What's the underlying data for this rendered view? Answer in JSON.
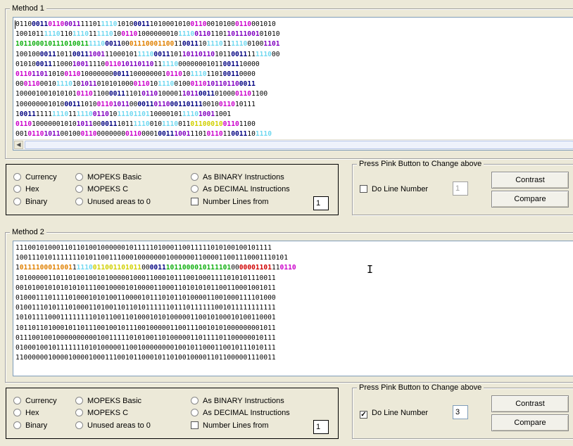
{
  "palette": {
    "black": "#000000",
    "navy": "#000080",
    "purple": "#8000c0",
    "magenta": "#cc00cc",
    "cyan": "#70d8f0",
    "green": "#10b010",
    "orange": "#e08000",
    "yellow": "#d0d000",
    "red": "#d00000"
  },
  "method1": {
    "title": "Method 1",
    "lines": [
      [
        [
          "0110",
          "black"
        ],
        [
          "0011",
          "navy",
          true
        ],
        [
          "0110",
          "magenta",
          true
        ],
        [
          "0011",
          "purple",
          true
        ],
        [
          "11101",
          "black"
        ],
        [
          "1110",
          "cyan",
          true
        ],
        [
          "1010",
          "black"
        ],
        [
          "0011",
          "navy",
          true
        ],
        [
          "1010001010",
          "black"
        ],
        [
          "0110",
          "magenta",
          true
        ],
        [
          "0010100",
          "black"
        ],
        [
          "0110",
          "magenta",
          true
        ],
        [
          "001010",
          "black"
        ]
      ],
      [
        [
          "1001011",
          "black"
        ],
        [
          "1110",
          "cyan",
          true
        ],
        [
          "110",
          "black"
        ],
        [
          "1110",
          "cyan",
          true
        ],
        [
          "11",
          "black"
        ],
        [
          "1110",
          "cyan",
          true
        ],
        [
          "10",
          "black"
        ],
        [
          "0110",
          "magenta",
          true
        ],
        [
          "1000000010",
          "black"
        ],
        [
          "1110",
          "cyan",
          true
        ],
        [
          "0110",
          "purple",
          true
        ],
        [
          "1101",
          "black"
        ],
        [
          "1011",
          "purple",
          true
        ],
        [
          "1001",
          "purple",
          true
        ],
        [
          "01010",
          "black"
        ]
      ],
      [
        [
          "101100010111010011",
          "green",
          true
        ],
        [
          "1110",
          "cyan",
          true
        ],
        [
          "0011",
          "navy",
          true
        ],
        [
          "00",
          "black"
        ],
        [
          "0111000",
          "orange",
          true
        ],
        [
          "1100",
          "orange",
          true
        ],
        [
          "11",
          "black"
        ],
        [
          "0011",
          "navy",
          true
        ],
        [
          "10",
          "black"
        ],
        [
          "1110",
          "cyan",
          true
        ],
        [
          "11",
          "black"
        ],
        [
          "1110",
          "cyan",
          true
        ],
        [
          "0100",
          "black"
        ],
        [
          "1101",
          "purple",
          true
        ]
      ],
      [
        [
          "100100",
          "black"
        ],
        [
          "0011",
          "navy",
          true
        ],
        [
          "1011",
          "black"
        ],
        [
          "0011",
          "navy",
          true
        ],
        [
          "1001",
          "purple",
          true
        ],
        [
          "11000101",
          "black"
        ],
        [
          "1110",
          "cyan",
          true
        ],
        [
          "0011",
          "navy",
          true
        ],
        [
          "101",
          "black"
        ],
        [
          "1011",
          "purple",
          true
        ],
        [
          "0110",
          "purple",
          true
        ],
        [
          "1011",
          "black"
        ],
        [
          "0011",
          "navy",
          true
        ],
        [
          "11",
          "black"
        ],
        [
          "1110",
          "cyan",
          true
        ],
        [
          "00",
          "black"
        ]
      ],
      [
        [
          "01010",
          "black"
        ],
        [
          "0011",
          "navy",
          true
        ],
        [
          "11000",
          "black"
        ],
        [
          "1001",
          "purple",
          true
        ],
        [
          "1110",
          "black"
        ],
        [
          "0110",
          "magenta",
          true
        ],
        [
          "1011",
          "purple",
          true
        ],
        [
          "0110",
          "purple",
          true
        ],
        [
          "11",
          "black"
        ],
        [
          "1110",
          "cyan",
          true
        ],
        [
          "00000001011",
          "black"
        ],
        [
          "0011",
          "navy",
          true
        ],
        [
          "10000",
          "black"
        ]
      ],
      [
        [
          "0110",
          "magenta",
          true
        ],
        [
          "1101",
          "purple",
          true
        ],
        [
          "1010",
          "black"
        ],
        [
          "0110",
          "magenta",
          true
        ],
        [
          "10",
          "black"
        ],
        [
          "000000",
          "black"
        ],
        [
          "0011",
          "navy",
          true
        ],
        [
          "100000001",
          "black"
        ],
        [
          "0110",
          "magenta",
          true
        ],
        [
          "10",
          "black"
        ],
        [
          "1110",
          "cyan",
          true
        ],
        [
          "1101",
          "black"
        ],
        [
          "0011",
          "navy",
          true
        ],
        [
          "0000",
          "black"
        ]
      ],
      [
        [
          "00",
          "black"
        ],
        [
          "0110",
          "magenta",
          true
        ],
        [
          "0010",
          "black"
        ],
        [
          "1110",
          "cyan",
          true
        ],
        [
          "10",
          "black"
        ],
        [
          "1011",
          "purple",
          true
        ],
        [
          "010101000",
          "black"
        ],
        [
          "0110",
          "magenta",
          true
        ],
        [
          "10",
          "black"
        ],
        [
          "1110",
          "cyan",
          true
        ],
        [
          "0100",
          "black"
        ],
        [
          "0110",
          "magenta",
          true
        ],
        [
          "1011",
          "purple",
          true
        ],
        [
          "0110",
          "purple",
          true
        ],
        [
          "0011",
          "navy",
          true
        ]
      ],
      [
        [
          "100001001010101",
          "black"
        ],
        [
          "0110",
          "magenta",
          true
        ],
        [
          "1100",
          "black"
        ],
        [
          "0011",
          "navy",
          true
        ],
        [
          "1101",
          "black"
        ],
        [
          "0110",
          "purple",
          true
        ],
        [
          "100001",
          "black"
        ],
        [
          "1011",
          "purple",
          true
        ],
        [
          "0011",
          "navy",
          true
        ],
        [
          "01000",
          "black"
        ],
        [
          "0110",
          "magenta",
          true
        ],
        [
          "1100",
          "black"
        ]
      ],
      [
        [
          "100000001010",
          "black"
        ],
        [
          "0011",
          "navy",
          true
        ],
        [
          "1010",
          "black"
        ],
        [
          "0110",
          "magenta",
          true
        ],
        [
          "1011",
          "purple",
          true
        ],
        [
          "00",
          "black"
        ],
        [
          "0011",
          "navy",
          true
        ],
        [
          "0110",
          "purple",
          true
        ],
        [
          "0011",
          "navy",
          true
        ],
        [
          "0111",
          "navy",
          true
        ],
        [
          "0010",
          "black"
        ],
        [
          "0110",
          "magenta",
          true
        ],
        [
          "10111",
          "black"
        ]
      ],
      [
        [
          "1",
          "black"
        ],
        [
          "0011",
          "navy",
          true
        ],
        [
          "1111",
          "black"
        ],
        [
          "1110",
          "cyan",
          true
        ],
        [
          "11",
          "black"
        ],
        [
          "1110",
          "cyan",
          true
        ],
        [
          "0110",
          "purple",
          true
        ],
        [
          "10",
          "black"
        ],
        [
          "1110",
          "cyan",
          true
        ],
        [
          "1101",
          "cyan",
          true
        ],
        [
          "1000",
          "black"
        ],
        [
          "0101",
          "black"
        ],
        [
          "1110",
          "cyan",
          true
        ],
        [
          "1001",
          "purple",
          true
        ],
        [
          "1001",
          "black"
        ]
      ],
      [
        [
          "0110",
          "magenta",
          true
        ],
        [
          "10000001010",
          "black"
        ],
        [
          "1011",
          "purple",
          true
        ],
        [
          "00",
          "black"
        ],
        [
          "0011",
          "navy",
          true
        ],
        [
          "1011",
          "black"
        ],
        [
          "1110",
          "cyan",
          true
        ],
        [
          "010",
          "black"
        ],
        [
          "1110",
          "cyan",
          true
        ],
        [
          "011",
          "black"
        ],
        [
          "0110",
          "yellow",
          true
        ],
        [
          "0010",
          "yellow",
          true
        ],
        [
          "0110",
          "magenta",
          true
        ],
        [
          "1100",
          "black"
        ]
      ],
      [
        [
          "001",
          "black"
        ],
        [
          "0110",
          "magenta",
          true
        ],
        [
          "1011",
          "purple",
          true
        ],
        [
          "00100",
          "black"
        ],
        [
          "0110",
          "magenta",
          true
        ],
        [
          "0000000",
          "black"
        ],
        [
          "0110",
          "magenta",
          true
        ],
        [
          "0001",
          "black"
        ],
        [
          "0011",
          "navy",
          true
        ],
        [
          "1001",
          "purple",
          true
        ],
        [
          "1101",
          "black"
        ],
        [
          "0110",
          "magenta",
          true
        ],
        [
          "11",
          "black"
        ],
        [
          "0011",
          "navy",
          true
        ],
        [
          "10",
          "black"
        ],
        [
          "1110",
          "cyan",
          true
        ]
      ]
    ]
  },
  "method2": {
    "title": "Method 2",
    "lines": [
      [
        [
          "111001010001101101001000000101111101000110011111010100100101111",
          "black"
        ]
      ],
      [
        [
          "1001110101111111010110011100010000000100000011000011001110001110101",
          "black"
        ]
      ],
      [
        [
          "1",
          "black"
        ],
        [
          "0111100011001",
          "orange",
          true
        ],
        [
          "1",
          "black"
        ],
        [
          "1110",
          "cyan",
          true
        ],
        [
          "0110",
          "yellow",
          true
        ],
        [
          "0110",
          "yellow",
          true
        ],
        [
          "1011",
          "yellow",
          true
        ],
        [
          "00",
          "black"
        ],
        [
          "0011",
          "navy",
          true
        ],
        [
          "1011",
          "green",
          true
        ],
        [
          "0000",
          "green",
          true
        ],
        [
          "1011",
          "green",
          true
        ],
        [
          "1101",
          "green",
          true
        ],
        [
          "00",
          "black"
        ],
        [
          "00001101",
          "red",
          true
        ],
        [
          "11",
          "black"
        ],
        [
          "0110",
          "magenta",
          true
        ]
      ],
      [
        [
          "1010000011011010010010100000100011000101110010001111010101110011",
          "black"
        ]
      ],
      [
        [
          "0010100101010101011100100001010000110001101010101100110001001011",
          "black"
        ]
      ],
      [
        [
          "0100011101111010001010100110000101110101101000011001000111101000",
          "black"
        ]
      ],
      [
        [
          "0100111010111010001101001101101011111101110111111001011111111111",
          "black"
        ]
      ],
      [
        [
          "1010111100011111111010110011010001010100000110010100010100110001",
          "black"
        ]
      ],
      [
        [
          "1011011010001011011100100101110010000011001110010101000000001011",
          "black"
        ]
      ],
      [
        [
          "0111001001000000000010011111010100110100000110111101100000010111",
          "black"
        ]
      ],
      [
        [
          "0100010010111111101010000011001000000001001011000110010111010111",
          "black"
        ]
      ],
      [
        [
          "1100000010000100001000111001011000101101001000011011000001110011",
          "black"
        ]
      ]
    ]
  },
  "options1": {
    "currency": "Currency",
    "hex": "Hex",
    "binary": "Binary",
    "mopeks_basic": "MOPEKS Basic",
    "mopeks_c": "MOPEKS C",
    "unused": "Unused areas to 0",
    "as_binary": "As BINARY Instructions",
    "as_decimal": "As DECIMAL Instructions",
    "number_lines": "Number Lines  from",
    "number_from": "1"
  },
  "press1": {
    "title": "Press Pink Button to Change above",
    "do_line_number": "Do Line Number",
    "line_number": "1",
    "contrast": "Contrast",
    "compare": "Compare"
  },
  "options2": {
    "currency": "Currency",
    "hex": "Hex",
    "binary": "Binary",
    "mopeks_basic": "MOPEKS Basic",
    "mopeks_c": "MOPEKS C",
    "unused": "Unused areas to 0",
    "as_binary": "As BINARY Instructions",
    "as_decimal": "As DECIMAL Instructions",
    "number_lines": "Number Lines  from",
    "number_from": "1"
  },
  "press2": {
    "title": "Press Pink Button to Change above",
    "do_line_number": "Do Line Number",
    "do_line_checked": "✓",
    "line_number": "3",
    "contrast": "Contrast",
    "compare": "Compare"
  }
}
